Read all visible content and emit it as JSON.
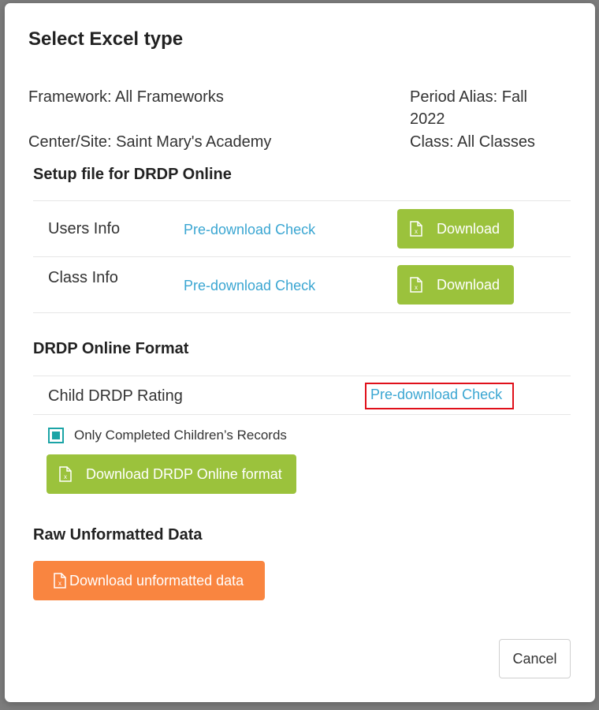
{
  "modal": {
    "title": "Select Excel type",
    "framework": "Framework: All Frameworks",
    "period_alias_line1": "Period Alias: Fall",
    "period_alias_line2": "2022",
    "center_site": "Center/Site: Saint Mary's Academy",
    "class": "Class: All Classes"
  },
  "setup": {
    "title": "Setup file for DRDP Online",
    "rows": [
      {
        "label": "Users Info",
        "check_label": "Pre-download Check",
        "download_label": "Download"
      },
      {
        "label": "Class Info",
        "check_label": "Pre-download Check",
        "download_label": "Download"
      }
    ]
  },
  "drdp_format": {
    "title": "DRDP Online Format",
    "row_label": "Child DRDP Rating",
    "check_label": "Pre-download Check",
    "checkbox_label": "Only Completed Children’s Records",
    "checkbox_checked": true,
    "download_label": "Download DRDP Online format"
  },
  "raw": {
    "title": "Raw Unformatted Data",
    "download_label": "Download unformatted data"
  },
  "footer": {
    "cancel_label": "Cancel"
  },
  "colors": {
    "green_button": "#9bc23c",
    "orange_button": "#f98540",
    "link": "#3aa6d2",
    "checkbox": "#1ba4a6",
    "highlight": "#e0101a"
  }
}
